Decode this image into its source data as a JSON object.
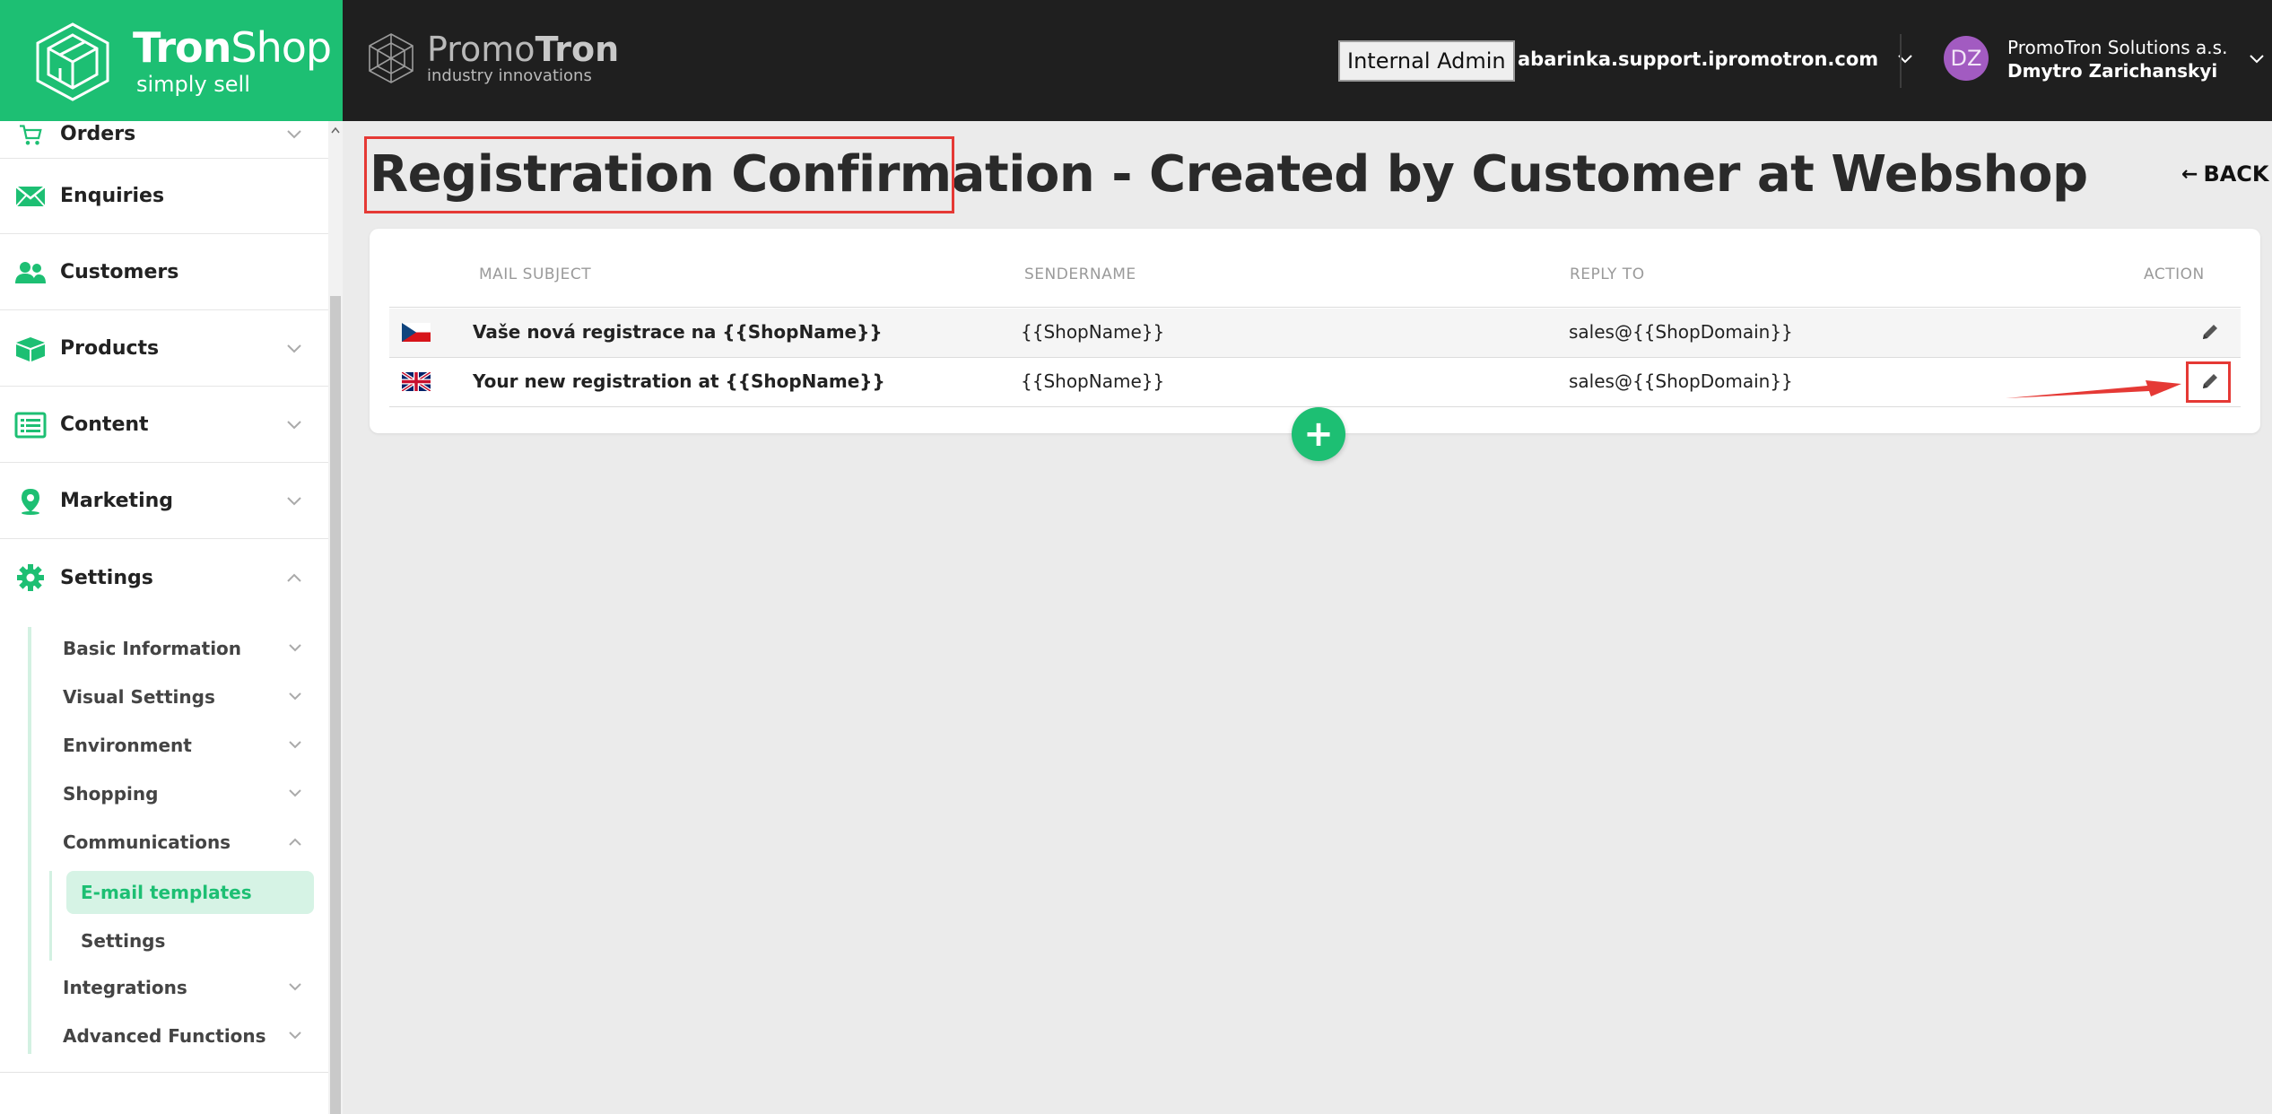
{
  "brand": {
    "name_bold": "Tron",
    "name_light": "Shop",
    "tagline": "simply sell"
  },
  "promo": {
    "name_light": "Promo",
    "name_bold": "Tron",
    "tagline": "industry innovations"
  },
  "header": {
    "internal_admin": "Internal Admin",
    "domain": "abarinka.support.ipromotron.com",
    "avatar_initials": "DZ",
    "company": "PromoTron Solutions a.s.",
    "username": "Dmytro Zarichanskyi"
  },
  "sidebar": {
    "items": [
      {
        "label": "Orders",
        "icon": "cart-icon"
      },
      {
        "label": "Enquiries",
        "icon": "envelope-icon"
      },
      {
        "label": "Customers",
        "icon": "users-icon"
      },
      {
        "label": "Products",
        "icon": "box-icon"
      },
      {
        "label": "Content",
        "icon": "list-icon"
      },
      {
        "label": "Marketing",
        "icon": "map-pin-icon"
      },
      {
        "label": "Settings",
        "icon": "gear-icon"
      }
    ],
    "settings_sub": [
      "Basic Information",
      "Visual Settings",
      "Environment",
      "Shopping",
      "Communications",
      "Integrations",
      "Advanced Functions"
    ],
    "communications_sub": [
      "E-mail templates",
      "Settings"
    ]
  },
  "page": {
    "title_highlighted": "Registration Confirmation",
    "title_rest": " - Created by Customer at Webshop",
    "back": "BACK"
  },
  "table": {
    "headers": {
      "subject": "MAIL SUBJECT",
      "sender": "SENDERNAME",
      "reply": "REPLY TO",
      "action": "ACTION"
    },
    "rows": [
      {
        "flag": "cz-flag",
        "subject": "Vaše nová registrace na {{ShopName}}",
        "sender": "{{ShopName}}",
        "reply": "sales@{{ShopDomain}}"
      },
      {
        "flag": "uk-flag",
        "subject": "Your new registration at {{ShopName}}",
        "sender": "{{ShopName}}",
        "reply": "sales@{{ShopDomain}}"
      }
    ]
  },
  "colors": {
    "brand_green": "#1dbf73",
    "topbar": "#1f1f1f",
    "highlight_red": "#e53935",
    "avatar": "#a25bc1"
  }
}
